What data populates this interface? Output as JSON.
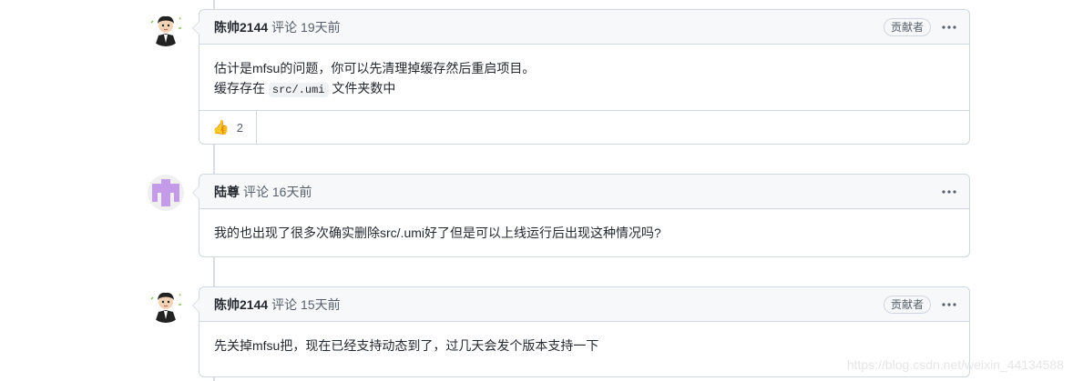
{
  "comments": [
    {
      "author": "陈帅2144",
      "meta": "评论 19天前",
      "badge": "贡献者",
      "body_line1": "估计是mfsu的问题，你可以先清理掉缓存然后重启项目。",
      "body_line2_prefix": "缓存存在 ",
      "body_line2_code": "src/.umi",
      "body_line2_suffix": " 文件夹数中",
      "reaction_emoji": "👍",
      "reaction_count": "2",
      "avatar": "cartoon-man-avatar"
    },
    {
      "author": "陆尊",
      "meta": "评论 16天前",
      "body": "我的也出现了很多次确实删除src/.umi好了但是可以上线运行后出现这种情况吗?",
      "avatar": "identicon-avatar"
    },
    {
      "author": "陈帅2144",
      "meta": "评论 15天前",
      "badge": "贡献者",
      "body": "先关掉mfsu把，现在已经支持动态到了，过几天会发个版本支持一下",
      "avatar": "cartoon-man-avatar"
    }
  ],
  "watermark": "https://blog.csdn.net/weixin_44134588",
  "colors": {
    "header_bg": "#f6f8fa",
    "border": "#d0d7de",
    "identicon": "#c39be8"
  }
}
